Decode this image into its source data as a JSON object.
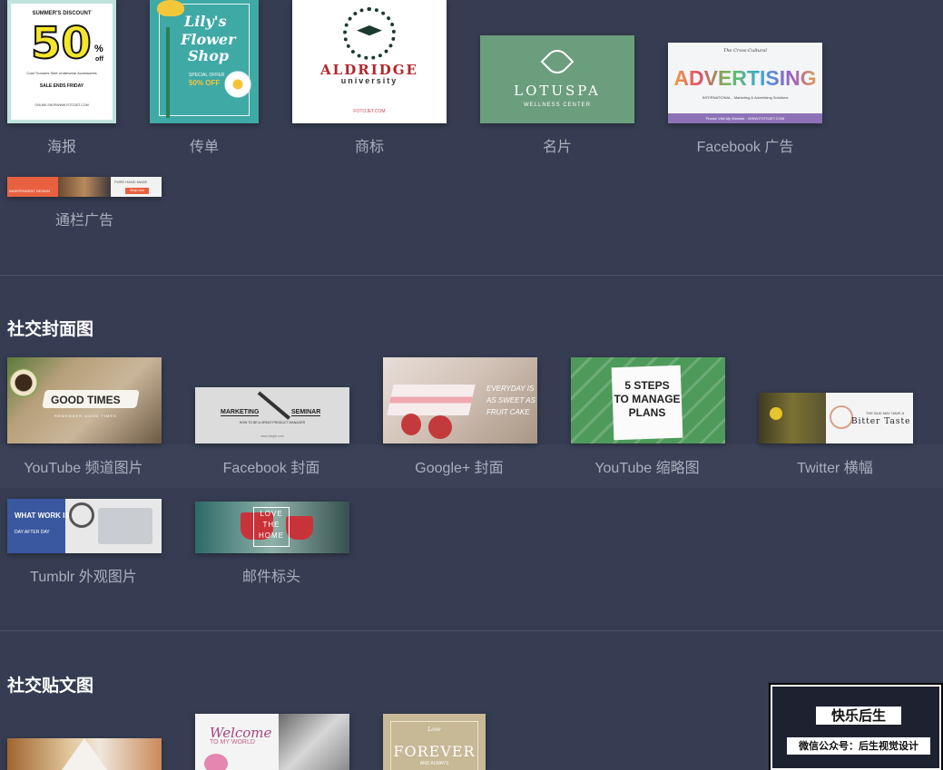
{
  "design_types": [
    {
      "label": "海报",
      "thumb": {
        "big": "50",
        "small_top": "SUMMER'S DISCOUNT",
        "small_side": "%",
        "off": "off",
        "items": "Coat  Trousers  Skirt  Underwear  Accessories",
        "sale": "SALE ENDS FRIDAY",
        "url": "ONLINE.SHOPWWW.FOTOJET.COM"
      }
    },
    {
      "label": "传单",
      "thumb": {
        "title_line1": "Lily's",
        "title_line2": "Flower",
        "title_line3": "Shop",
        "offer_line1": "SPECIAL OFFER",
        "offer_line2": "50% OFF"
      }
    },
    {
      "label": "商标",
      "thumb": {
        "name": "ALDRIDGE",
        "sub": "university",
        "url": "FOTOJET.COM"
      }
    },
    {
      "label": "名片",
      "thumb": {
        "name": "LOTUSPA",
        "sub": "WELLNESS CENTER"
      }
    },
    {
      "label": "Facebook 广告",
      "thumb": {
        "word": "ADVERTISING",
        "top": "The Cross-Cultural",
        "line": "INTERNATIONAL - Marketing & Advertising Solutions",
        "bar": "Please Visit My Website : WWW.FOTOJET.COM"
      }
    },
    {
      "label": "通栏广告",
      "thumb": {
        "left": "INDEPENDENT DESIGN",
        "right": "PURE HAND MADE",
        "btn": "Shop now"
      }
    }
  ],
  "social_cover": {
    "title": "社交封面图",
    "items": [
      {
        "label": "YouTube 频道图片",
        "thumb": {
          "text": "GOOD TIMES",
          "sub": "REMEMBER GOOD TIMES"
        }
      },
      {
        "label": "Facebook 封面",
        "thumb": {
          "left": "MARKETING",
          "right": "SEMINAR",
          "sub": "HOW TO BE A GREAT PRODUCT MANAGER",
          "url": "www.fotojet.com"
        }
      },
      {
        "label": "Google+ 封面",
        "thumb": {
          "line1": "EVERYDAY IS",
          "line2": "AS SWEET AS",
          "line3": "FRUIT CAKE"
        }
      },
      {
        "label": "YouTube 缩略图",
        "thumb": {
          "line1": "5 STEPS",
          "line2": "TO MANAGE",
          "line3": "PLANS"
        }
      },
      {
        "label": "Twitter 横幅",
        "thumb": {
          "small": "THE BUD MAY HAVE A",
          "big": "Bitter Taste"
        }
      },
      {
        "label": "Tumblr 外观图片",
        "thumb": {
          "line1": "WHAT WORK IS",
          "line2": "DAY AFTER DAY"
        }
      },
      {
        "label": "邮件标头",
        "thumb": {
          "line1": "LOVE",
          "line2": "THE",
          "line3": "HOME"
        }
      }
    ]
  },
  "social_post": {
    "title": "社交贴文图",
    "items": [
      {
        "thumb": {}
      },
      {
        "thumb": {
          "line1": "Welcome",
          "line2": "TO MY WORLD"
        }
      },
      {
        "thumb": {
          "small": "Love",
          "big": "FOREVER",
          "sub": "AND ALWAYS"
        }
      }
    ]
  },
  "watermark": {
    "title": "快乐后生",
    "sub": "微信公众号：后生视觉设计"
  },
  "colors": {
    "background": "#363d52",
    "band": "#3b4258",
    "title": "#ffffff",
    "label": "#a9afbd"
  }
}
